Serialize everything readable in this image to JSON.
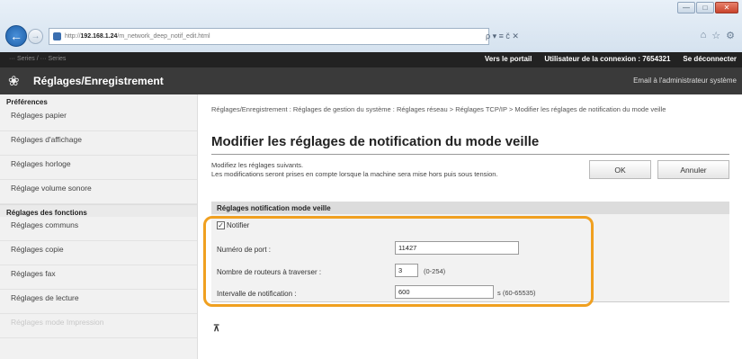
{
  "browser": {
    "url_prefix": "http://",
    "url_host": "192.168.1.24",
    "url_path": "/m_network_deep_notif_edit.html",
    "search_hint": "ρ ▾ ≡ č ✕"
  },
  "topbar": {
    "device": "··· Series / ··· Series",
    "portal": "Vers le portail",
    "user": "Utilisateur de la connexion : 7654321",
    "logout": "Se déconnecter"
  },
  "header": {
    "title": "Réglages/Enregistrement",
    "mail": "Email à l'administrateur système"
  },
  "sidebar": {
    "section1": "Préférences",
    "items1": [
      "Réglages papier",
      "Réglages d'affichage",
      "Réglages horloge",
      "Réglage volume sonore"
    ],
    "section2": "Réglages des fonctions",
    "items2": [
      "Réglages communs",
      "Réglages copie",
      "Réglages fax",
      "Réglages de lecture",
      "Réglages mode Impression"
    ]
  },
  "main": {
    "breadcrumb": "Réglages/Enregistrement : Réglages de gestion du système : Réglages réseau > Réglages TCP/IP > Modifier les réglages de notification du mode veille",
    "title": "Modifier les réglages de notification du mode veille",
    "desc1": "Modifiez les réglages suivants.",
    "desc2": "Les modifications seront prises en compte lorsque la machine sera mise hors puis sous tension.",
    "ok": "OK",
    "cancel": "Annuler",
    "panel_title": "Réglages notification mode veille",
    "notify_label": "Notifier",
    "notify_checked": true,
    "port_label": "Numéro de port :",
    "port_value": "11427",
    "routers_label": "Nombre de routeurs à traverser :",
    "routers_value": "3",
    "routers_hint": "(0-254)",
    "interval_label": "Intervalle de notification :",
    "interval_value": "600",
    "interval_hint": "s (60-65535)"
  }
}
